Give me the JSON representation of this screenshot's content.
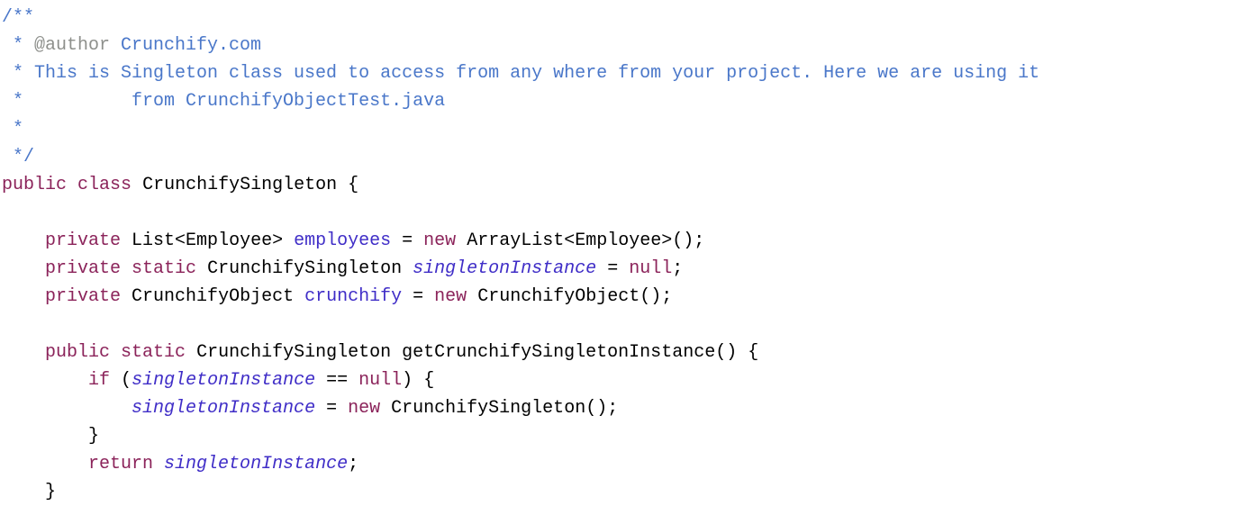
{
  "code": {
    "doc": {
      "open": "/**",
      "star": " *",
      "authorPrefix": " * ",
      "authorTag": "@author",
      "authorValue": " Crunchify.com",
      "line1": " * This is Singleton class used to access from any where from your project. Here we are using it",
      "line2": " *          from CrunchifyObjectTest.java",
      "close": " */"
    },
    "kw": {
      "public": "public",
      "class": "class",
      "private": "private",
      "static": "static",
      "new": "new",
      "if": "if",
      "null": "null",
      "return": "return"
    },
    "ids": {
      "className": "CrunchifySingleton",
      "listEmployee": "List<Employee>",
      "employees": "employees",
      "arrayListEmployee": "ArrayList<Employee>()",
      "singletonInstance": "singletonInstance",
      "crunchifyObject": "CrunchifyObject",
      "crunchify": "crunchify",
      "crunchifyObjectCall": "CrunchifyObject()",
      "getInstance": "getCrunchifySingletonInstance()",
      "ctorCall": "CrunchifySingleton()"
    },
    "sym": {
      "openBrace": "{",
      "closeBrace": "}",
      "eq": "=",
      "eqeq": "==",
      "semi": ";",
      "lparen": "(",
      "rparen": ")"
    }
  }
}
